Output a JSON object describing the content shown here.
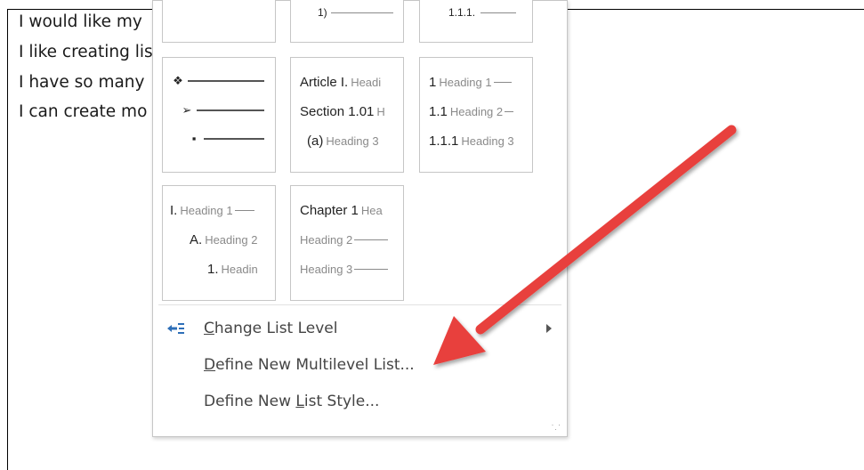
{
  "document": {
    "lines": [
      "I would like my",
      "I like creating lis",
      "I have so many",
      "I can create mo"
    ]
  },
  "menu": {
    "top_row_fragments": [
      "1)",
      "1.1.1."
    ],
    "thumbnails": {
      "bullets": {
        "glyphs": [
          "❖",
          "➢",
          "▪"
        ]
      },
      "article": {
        "rows": [
          {
            "label": "Article I.",
            "heading": "Headi"
          },
          {
            "label": "Section 1.01",
            "heading": "H"
          },
          {
            "label": "(a)",
            "heading": "Heading 3"
          }
        ]
      },
      "numeric": {
        "rows": [
          {
            "label": "1",
            "heading": "Heading 1"
          },
          {
            "label": "1.1",
            "heading": "Heading 2"
          },
          {
            "label": "1.1.1",
            "heading": "Heading 3"
          }
        ]
      },
      "roman": {
        "rows": [
          {
            "label": "I.",
            "heading": "Heading 1"
          },
          {
            "label": "A.",
            "heading": "Heading 2"
          },
          {
            "label": "1.",
            "heading": "Headin"
          }
        ]
      },
      "chapter": {
        "rows": [
          {
            "label": "Chapter 1",
            "heading": "Hea"
          },
          {
            "label": "",
            "heading": "Heading 2"
          },
          {
            "label": "",
            "heading": "Heading 3"
          }
        ]
      }
    },
    "commands": [
      {
        "pre": "",
        "key": "C",
        "post": "hange List Level"
      },
      {
        "pre": "",
        "key": "D",
        "post": "efine New Multilevel List..."
      },
      {
        "pre": "Define New ",
        "key": "L",
        "post": "ist Style..."
      }
    ]
  },
  "colors": {
    "arrow": "#e8413c",
    "icon_blue": "#2e6fb8"
  },
  "icons": [
    "change-list-level-icon",
    "submenu-arrow-icon",
    "resize-grip-icon"
  ]
}
